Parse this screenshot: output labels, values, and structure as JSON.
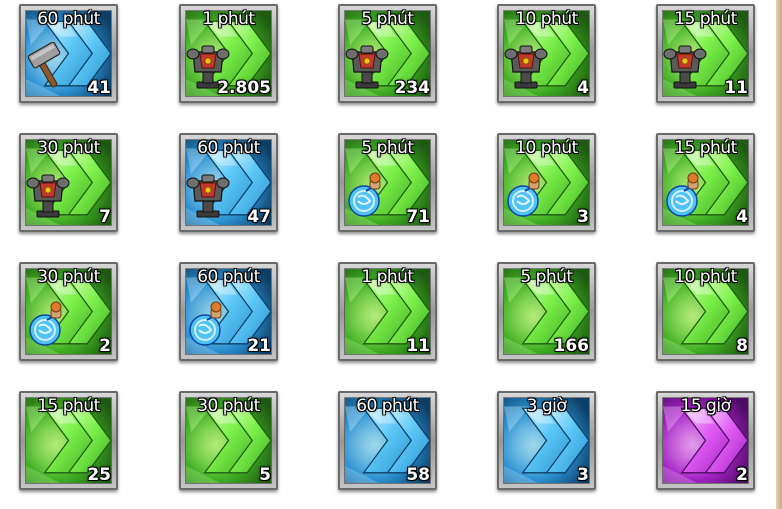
{
  "colors": {
    "green": "#3fcf2a",
    "blue": "#2a9fd8",
    "purple": "#b52ad0"
  },
  "items": [
    {
      "duration": "60 phút",
      "quantity": "41",
      "color": "blue",
      "icon": "hammer-icon"
    },
    {
      "duration": "1 phút",
      "quantity": "2.805",
      "color": "green",
      "icon": "armor-icon"
    },
    {
      "duration": "5 phút",
      "quantity": "234",
      "color": "green",
      "icon": "armor-icon"
    },
    {
      "duration": "10 phút",
      "quantity": "4",
      "color": "green",
      "icon": "armor-icon"
    },
    {
      "duration": "15 phút",
      "quantity": "11",
      "color": "green",
      "icon": "armor-icon"
    },
    {
      "duration": "30 phút",
      "quantity": "7",
      "color": "green",
      "icon": "armor-icon"
    },
    {
      "duration": "60 phút",
      "quantity": "47",
      "color": "blue",
      "icon": "armor-icon"
    },
    {
      "duration": "5 phút",
      "quantity": "71",
      "color": "green",
      "icon": "potion-icon"
    },
    {
      "duration": "10 phút",
      "quantity": "3",
      "color": "green",
      "icon": "potion-icon"
    },
    {
      "duration": "15 phút",
      "quantity": "4",
      "color": "green",
      "icon": "potion-icon"
    },
    {
      "duration": "30 phút",
      "quantity": "2",
      "color": "green",
      "icon": "potion-icon"
    },
    {
      "duration": "60 phút",
      "quantity": "21",
      "color": "blue",
      "icon": "potion-icon"
    },
    {
      "duration": "1 phút",
      "quantity": "11",
      "color": "green",
      "icon": ""
    },
    {
      "duration": "5 phút",
      "quantity": "166",
      "color": "green",
      "icon": ""
    },
    {
      "duration": "10 phút",
      "quantity": "8",
      "color": "green",
      "icon": ""
    },
    {
      "duration": "15 phút",
      "quantity": "25",
      "color": "green",
      "icon": ""
    },
    {
      "duration": "30 phút",
      "quantity": "5",
      "color": "green",
      "icon": ""
    },
    {
      "duration": "60 phút",
      "quantity": "58",
      "color": "blue",
      "icon": ""
    },
    {
      "duration": "3 giờ",
      "quantity": "3",
      "color": "blue",
      "icon": ""
    },
    {
      "duration": "15 giờ",
      "quantity": "2",
      "color": "purple",
      "icon": ""
    }
  ]
}
